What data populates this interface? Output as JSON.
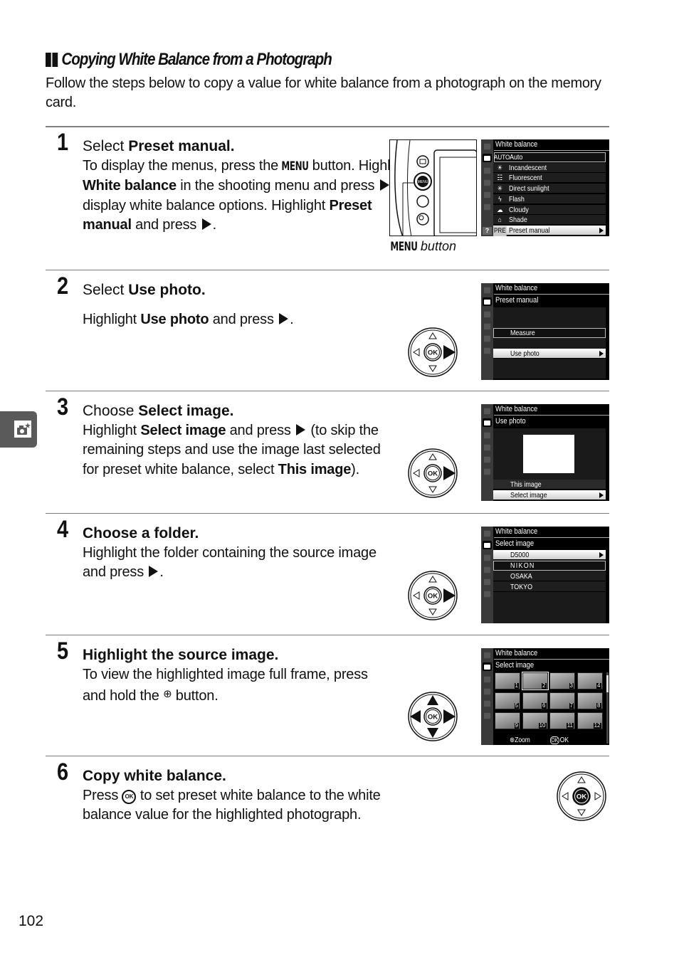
{
  "section": {
    "title": "Copying White Balance from a Photograph",
    "intro": "Follow the steps below to copy a value for white balance from a photograph on the memory card."
  },
  "steps": [
    {
      "number": "1",
      "title_plain": "Select ",
      "title_bold": "Preset manual.",
      "body": [
        {
          "t": "To display the menus, press the "
        },
        {
          "menu": "MENU"
        },
        {
          "t": " button. Highlight "
        },
        {
          "b": "White balance"
        },
        {
          "t": " in the shooting menu and press "
        },
        {
          "tri": true
        },
        {
          "t": " to display white balance options.  Highlight "
        },
        {
          "b": "Preset manual"
        },
        {
          "t": " and press "
        },
        {
          "tri": true
        },
        {
          "t": "."
        }
      ],
      "caption_menu": "MENU",
      "caption_text": "button",
      "screen": {
        "header": "White balance",
        "items": [
          {
            "prefix": "AUTO",
            "label": "Auto",
            "state": "boxed"
          },
          {
            "prefix": "☀",
            "label": "Incandescent",
            "state": ""
          },
          {
            "prefix": "☷",
            "label": "Fluorescent",
            "state": ""
          },
          {
            "prefix": "✳",
            "label": "Direct sunlight",
            "state": ""
          },
          {
            "prefix": "ϟ",
            "label": "Flash",
            "state": ""
          },
          {
            "prefix": "☁",
            "label": "Cloudy",
            "state": ""
          },
          {
            "prefix": "⌂",
            "label": "Shade",
            "state": ""
          },
          {
            "prefix": "PRE",
            "label": "Preset manual",
            "state": "hl"
          }
        ],
        "help": "?"
      }
    },
    {
      "number": "2",
      "title_plain": "Select ",
      "title_bold": "Use photo.",
      "body": [
        {
          "t": "Highlight "
        },
        {
          "b": "Use photo"
        },
        {
          "t": " and press "
        },
        {
          "tri": true
        },
        {
          "t": "."
        }
      ],
      "screen": {
        "header": "White balance",
        "subheader": "Preset manual",
        "items": [
          {
            "label": "Measure",
            "state": "boxed"
          },
          {
            "label": "Use photo",
            "state": "hl"
          }
        ]
      }
    },
    {
      "number": "3",
      "title_plain": "Choose ",
      "title_bold": "Select image.",
      "body": [
        {
          "t": "Highlight "
        },
        {
          "b": "Select image"
        },
        {
          "t": " and press "
        },
        {
          "tri": true
        },
        {
          "t": " (to skip the remaining steps and use the image last selected for preset white balance, select "
        },
        {
          "b": "This image"
        },
        {
          "t": ")."
        }
      ],
      "screen": {
        "header": "White balance",
        "subheader": "Use photo",
        "items": [
          {
            "label": "This image",
            "state": ""
          },
          {
            "label": "Select image",
            "state": "hl"
          }
        ]
      }
    },
    {
      "number": "4",
      "title_plain": "Choose a folder.",
      "title_bold": "",
      "body": [
        {
          "t": "Highlight the folder containing the source image and press "
        },
        {
          "tri": true
        },
        {
          "t": "."
        }
      ],
      "screen": {
        "header": "White balance",
        "subheader": "Select image",
        "items": [
          {
            "label": "D5000",
            "state": "hl"
          },
          {
            "label": "NIKON",
            "state": "boxed"
          },
          {
            "label": "OSAKA",
            "state": ""
          },
          {
            "label": "TOKYO",
            "state": ""
          }
        ]
      }
    },
    {
      "number": "5",
      "title_plain": "Highlight the source image.",
      "title_bold": "",
      "body": [
        {
          "t": "To view the highlighted image full frame, press and hold the "
        },
        {
          "zoom": "⊕"
        },
        {
          "t": " button."
        }
      ],
      "screen": {
        "header": "White balance",
        "subheader": "Select image",
        "thumbnails": [
          "1",
          "2",
          "3",
          "4",
          "5",
          "6",
          "7",
          "8",
          "9",
          "10",
          "11",
          "12"
        ],
        "selected_thumbnail": "2",
        "footer_zoom": "Zoom",
        "footer_ok": "OK"
      }
    },
    {
      "number": "6",
      "title_plain": "Copy white balance.",
      "title_bold": "",
      "body": [
        {
          "t": "Press "
        },
        {
          "ok": "OK"
        },
        {
          "t": " to set preset white balance to the white balance value for the highlighted photograph."
        }
      ]
    }
  ],
  "dial": {
    "center_label": "OK"
  },
  "page_number": "102"
}
